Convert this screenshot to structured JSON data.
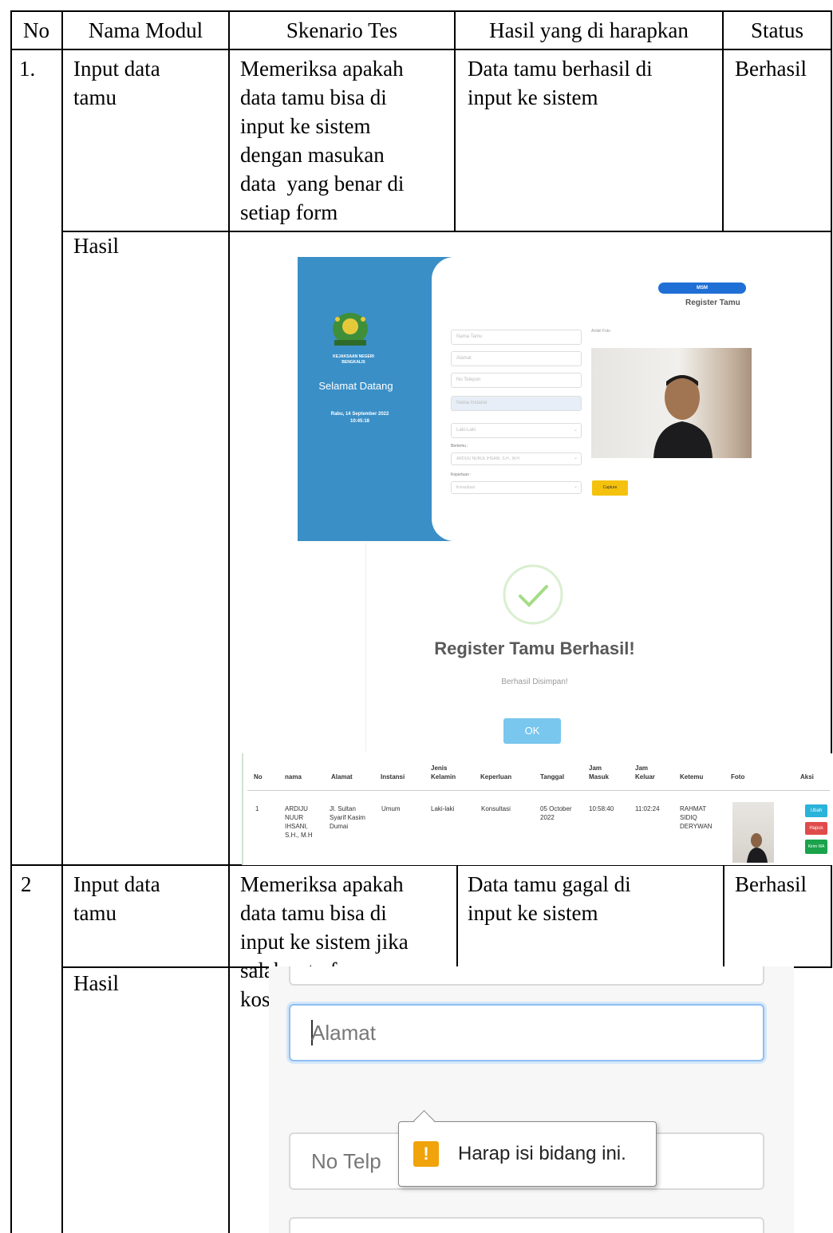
{
  "table": {
    "headers": {
      "no": "No",
      "modul": "Nama Modul",
      "skenario": "Skenario Tes",
      "hasil": "Hasil yang di harapkan",
      "status": "Status"
    },
    "rows": [
      {
        "no": "1.",
        "modul": [
          "Input data",
          "tamu"
        ],
        "skenario": [
          "Memeriksa apakah",
          "data tamu bisa di",
          "input ke sistem",
          "dengan masukan",
          "data  yang benar di",
          "setiap form"
        ],
        "hasil": [
          "Data tamu berhasil di",
          "input ke sistem"
        ],
        "status": "Berhasil",
        "result_label": "Hasil"
      },
      {
        "no": "2",
        "modul": [
          "Input data",
          "tamu"
        ],
        "skenario": [
          "Memeriksa apakah",
          "data tamu bisa di",
          "input ke sistem jika",
          "salah satu form",
          "kosong"
        ],
        "hasil": [
          "Data tamu gagal di",
          "input ke sistem"
        ],
        "status": "Berhasil",
        "result_label": "Hasil"
      }
    ]
  },
  "register_form": {
    "top_button": "MSM",
    "title": "Register Tamu",
    "welcome": "Selamat Datang",
    "brand_line1": "KEJAKSAAN NEGERI",
    "brand_line2": "BENGKALIS",
    "date_line1": "Rabu, 14 September 2022",
    "date_line2": "10:45:18",
    "fields": [
      "Nama Tamu",
      "Alamat",
      "No Telepon",
      "Nama Instansi"
    ],
    "gender_value": "Laki-Laki",
    "bertemu_label": "Bertemu :",
    "bertemu_value": "ARDIJU NURUL IHSANI, S.H., M.H",
    "keperluan_label": "Keperluan :",
    "keperluan_value": "Konsultasi",
    "camera_label": "Ambil Foto",
    "capture_button": "Capture",
    "colors": {
      "sidebar": "#3a8fc7",
      "capture": "#f4c20d",
      "top_button": "#1f6fd6"
    }
  },
  "success_dialog": {
    "title": "Register Tamu Berhasil!",
    "subtitle": "Berhasil Disimpan!",
    "ok": "OK",
    "icon": "check-circle-icon"
  },
  "guest_list": {
    "headers": [
      "No",
      "nama",
      "Alamat",
      "Instansi",
      "Jenis Kelamin",
      "Keperluan",
      "Tanggal",
      "Jam Masuk",
      "Jam Keluar",
      "Ketemu",
      "Foto",
      "Aksi"
    ],
    "row": {
      "no": "1",
      "nama": [
        "ARDIJU",
        "NUUR",
        "IHSANI,",
        "S.H., M.H"
      ],
      "alamat": [
        "Jl. Sultan",
        "Syarif Kasim",
        "Dumai"
      ],
      "instansi": "Umum",
      "jenis_kelamin": "Laki-laki",
      "keperluan": "Konsultasi",
      "tanggal": [
        "05 October",
        "2022"
      ],
      "jam_masuk": "10:58:40",
      "jam_keluar": "11:02:24",
      "ketemu": [
        "RAHMAT",
        "SIDIQ",
        "DERYWAN"
      ],
      "actions": [
        "Ubah",
        "Hapus",
        "Kirim WA"
      ]
    }
  },
  "validation": {
    "alamat_placeholder": "Alamat",
    "telp_placeholder": "No Telp",
    "tooltip": "Harap isi bidang ini.",
    "tooltip_icon": "!"
  }
}
